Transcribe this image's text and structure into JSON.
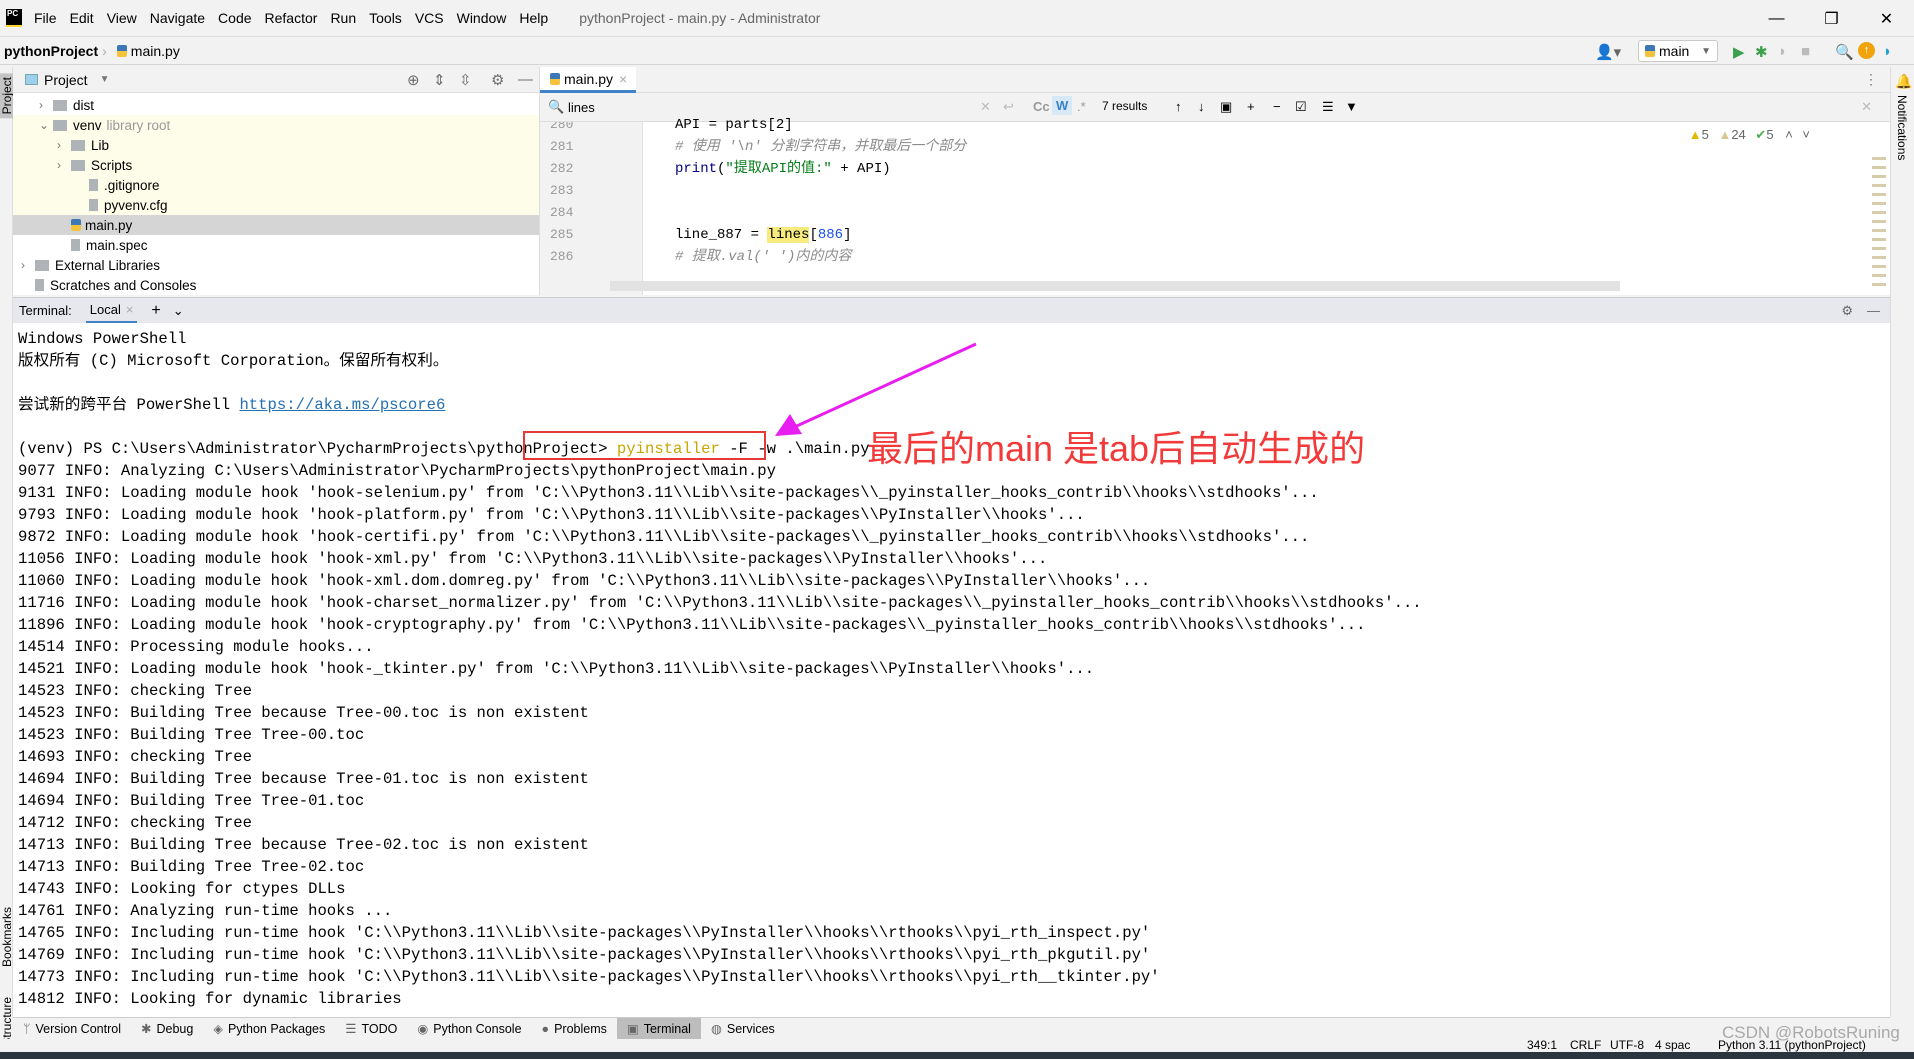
{
  "window": {
    "title": "pythonProject - main.py - Administrator",
    "logo": "PC"
  },
  "menu": [
    "File",
    "Edit",
    "View",
    "Navigate",
    "Code",
    "Refactor",
    "Run",
    "Tools",
    "VCS",
    "Window",
    "Help"
  ],
  "breadcrumb": {
    "project": "pythonProject",
    "file": "main.py"
  },
  "toolbar": {
    "run_config": "main"
  },
  "project_panel": {
    "title": "Project",
    "tree": [
      {
        "label": "dist",
        "type": "folder",
        "indent": 1,
        "arrow": ">"
      },
      {
        "label": "venv",
        "suffix": "library root",
        "type": "folder",
        "indent": 1,
        "arrow": "v"
      },
      {
        "label": "Lib",
        "type": "folder",
        "indent": 2,
        "arrow": ">"
      },
      {
        "label": "Scripts",
        "type": "folder",
        "indent": 2,
        "arrow": ">"
      },
      {
        "label": ".gitignore",
        "type": "file",
        "indent": 3
      },
      {
        "label": "pyvenv.cfg",
        "type": "file",
        "indent": 3
      },
      {
        "label": "main.py",
        "type": "py",
        "indent": 2,
        "selected": true
      },
      {
        "label": "main.spec",
        "type": "file",
        "indent": 2
      },
      {
        "label": "External Libraries",
        "type": "lib",
        "indent": 0,
        "arrow": ">"
      },
      {
        "label": "Scratches and Consoles",
        "type": "scratch",
        "indent": 0
      }
    ]
  },
  "editor": {
    "tab": "main.py",
    "search": {
      "query": "lines",
      "results": "7 results",
      "case_label": "Cc",
      "word_label": "W",
      "regex_label": ".*"
    },
    "inspections": {
      "warnings": "5",
      "weak_warnings": "24",
      "typos": "5"
    },
    "line_numbers": [
      "280",
      "281",
      "282",
      "283",
      "284",
      "285",
      "286"
    ],
    "lines": [
      [
        {
          "t": "API = parts[2]"
        }
      ],
      [
        {
          "t": "# 使用 '\\n' 分割字符串，并取最后一个部分",
          "c": "cm"
        }
      ],
      [
        {
          "t": "print",
          "c": "fn"
        },
        {
          "t": "("
        },
        {
          "t": "\"提取API的值:\"",
          "c": "st"
        },
        {
          "t": " + API)"
        }
      ],
      [],
      [],
      [
        {
          "t": "line_887 = "
        },
        {
          "t": "lines",
          "c": "hl"
        },
        {
          "t": "["
        },
        {
          "t": "886",
          "c": "nm"
        },
        {
          "t": "]"
        }
      ],
      [
        {
          "t": "# 提取.val(' ')内的内容",
          "c": "cm"
        }
      ]
    ]
  },
  "terminal": {
    "label": "Terminal:",
    "tab": "Local",
    "prompt": "(venv) PS C:\\Users\\Administrator\\PycharmProjects\\pythonProject> ",
    "command_name": "pyinstaller",
    "command_args": " -F -w .\\main.py",
    "link_prefix": "尝试新的跨平台 PowerShell ",
    "link": "https://aka.ms/pscore6",
    "header_lines": [
      "Windows PowerShell",
      "版权所有 (C) Microsoft Corporation。保留所有权利。",
      ""
    ],
    "output": [
      "9077 INFO: Analyzing C:\\Users\\Administrator\\PycharmProjects\\pythonProject\\main.py",
      "9131 INFO: Loading module hook 'hook-selenium.py' from 'C:\\\\Python3.11\\\\Lib\\\\site-packages\\\\_pyinstaller_hooks_contrib\\\\hooks\\\\stdhooks'...",
      "9793 INFO: Loading module hook 'hook-platform.py' from 'C:\\\\Python3.11\\\\Lib\\\\site-packages\\\\PyInstaller\\\\hooks'...",
      "9872 INFO: Loading module hook 'hook-certifi.py' from 'C:\\\\Python3.11\\\\Lib\\\\site-packages\\\\_pyinstaller_hooks_contrib\\\\hooks\\\\stdhooks'...",
      "11056 INFO: Loading module hook 'hook-xml.py' from 'C:\\\\Python3.11\\\\Lib\\\\site-packages\\\\PyInstaller\\\\hooks'...",
      "11060 INFO: Loading module hook 'hook-xml.dom.domreg.py' from 'C:\\\\Python3.11\\\\Lib\\\\site-packages\\\\PyInstaller\\\\hooks'...",
      "11716 INFO: Loading module hook 'hook-charset_normalizer.py' from 'C:\\\\Python3.11\\\\Lib\\\\site-packages\\\\_pyinstaller_hooks_contrib\\\\hooks\\\\stdhooks'...",
      "11896 INFO: Loading module hook 'hook-cryptography.py' from 'C:\\\\Python3.11\\\\Lib\\\\site-packages\\\\_pyinstaller_hooks_contrib\\\\hooks\\\\stdhooks'...",
      "14514 INFO: Processing module hooks...",
      "14521 INFO: Loading module hook 'hook-_tkinter.py' from 'C:\\\\Python3.11\\\\Lib\\\\site-packages\\\\PyInstaller\\\\hooks'...",
      "14523 INFO: checking Tree",
      "14523 INFO: Building Tree because Tree-00.toc is non existent",
      "14523 INFO: Building Tree Tree-00.toc",
      "14693 INFO: checking Tree",
      "14694 INFO: Building Tree because Tree-01.toc is non existent",
      "14694 INFO: Building Tree Tree-01.toc",
      "14712 INFO: checking Tree",
      "14713 INFO: Building Tree because Tree-02.toc is non existent",
      "14713 INFO: Building Tree Tree-02.toc",
      "14743 INFO: Looking for ctypes DLLs",
      "14761 INFO: Analyzing run-time hooks ...",
      "14765 INFO: Including run-time hook 'C:\\\\Python3.11\\\\Lib\\\\site-packages\\\\PyInstaller\\\\hooks\\\\rthooks\\\\pyi_rth_inspect.py'",
      "14769 INFO: Including run-time hook 'C:\\\\Python3.11\\\\Lib\\\\site-packages\\\\PyInstaller\\\\hooks\\\\rthooks\\\\pyi_rth_pkgutil.py'",
      "14773 INFO: Including run-time hook 'C:\\\\Python3.11\\\\Lib\\\\site-packages\\\\PyInstaller\\\\hooks\\\\rthooks\\\\pyi_rth__tkinter.py'",
      "14812 INFO: Looking for dynamic libraries"
    ]
  },
  "annotation": {
    "note": "最后的main 是tab后自动生成的",
    "color": "#f33a3a",
    "arrow_color": "#e81ef0"
  },
  "side": {
    "left_top": "Project",
    "left_bookmarks": "Bookmarks",
    "left_structure": "Structure",
    "right": "Notifications"
  },
  "bottom_tabs": [
    {
      "label": "Version Control",
      "icon": "branch-icon"
    },
    {
      "label": "Debug",
      "icon": "bug-icon"
    },
    {
      "label": "Python Packages",
      "icon": "packages-icon"
    },
    {
      "label": "TODO",
      "icon": "list-icon"
    },
    {
      "label": "Python Console",
      "icon": "python-icon"
    },
    {
      "label": "Problems",
      "icon": "warning-icon"
    },
    {
      "label": "Terminal",
      "icon": "terminal-icon",
      "active": true
    },
    {
      "label": "Services",
      "icon": "services-icon"
    }
  ],
  "status": {
    "position": "349:1",
    "line_ending": "CRLF",
    "encoding": "UTF-8",
    "indent": "4 spac",
    "interpreter": "Python 3.11 (pythonProject)",
    "watermark": "CSDN @RobotsRuning"
  },
  "colors": {
    "accent": "#4083c9",
    "highlight": "#f6eb7c",
    "selection": "#d5d5d5"
  }
}
